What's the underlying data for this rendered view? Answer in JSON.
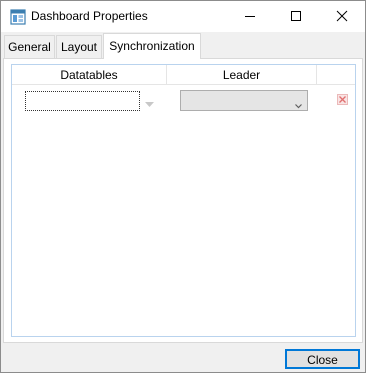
{
  "window": {
    "title": "Dashboard Properties",
    "controls": {
      "minimize": "minimize",
      "maximize": "maximize",
      "close": "close"
    }
  },
  "tabs": [
    {
      "label": "General",
      "active": false
    },
    {
      "label": "Layout",
      "active": false
    },
    {
      "label": "Synchronization",
      "active": true
    }
  ],
  "grid": {
    "columns": [
      "Datatables",
      "Leader",
      ""
    ],
    "rows": [
      {
        "datatable": "",
        "leader": ""
      }
    ]
  },
  "footer": {
    "close_label": "Close"
  },
  "colors": {
    "accent": "#0078d7",
    "delete": "#e07070"
  }
}
